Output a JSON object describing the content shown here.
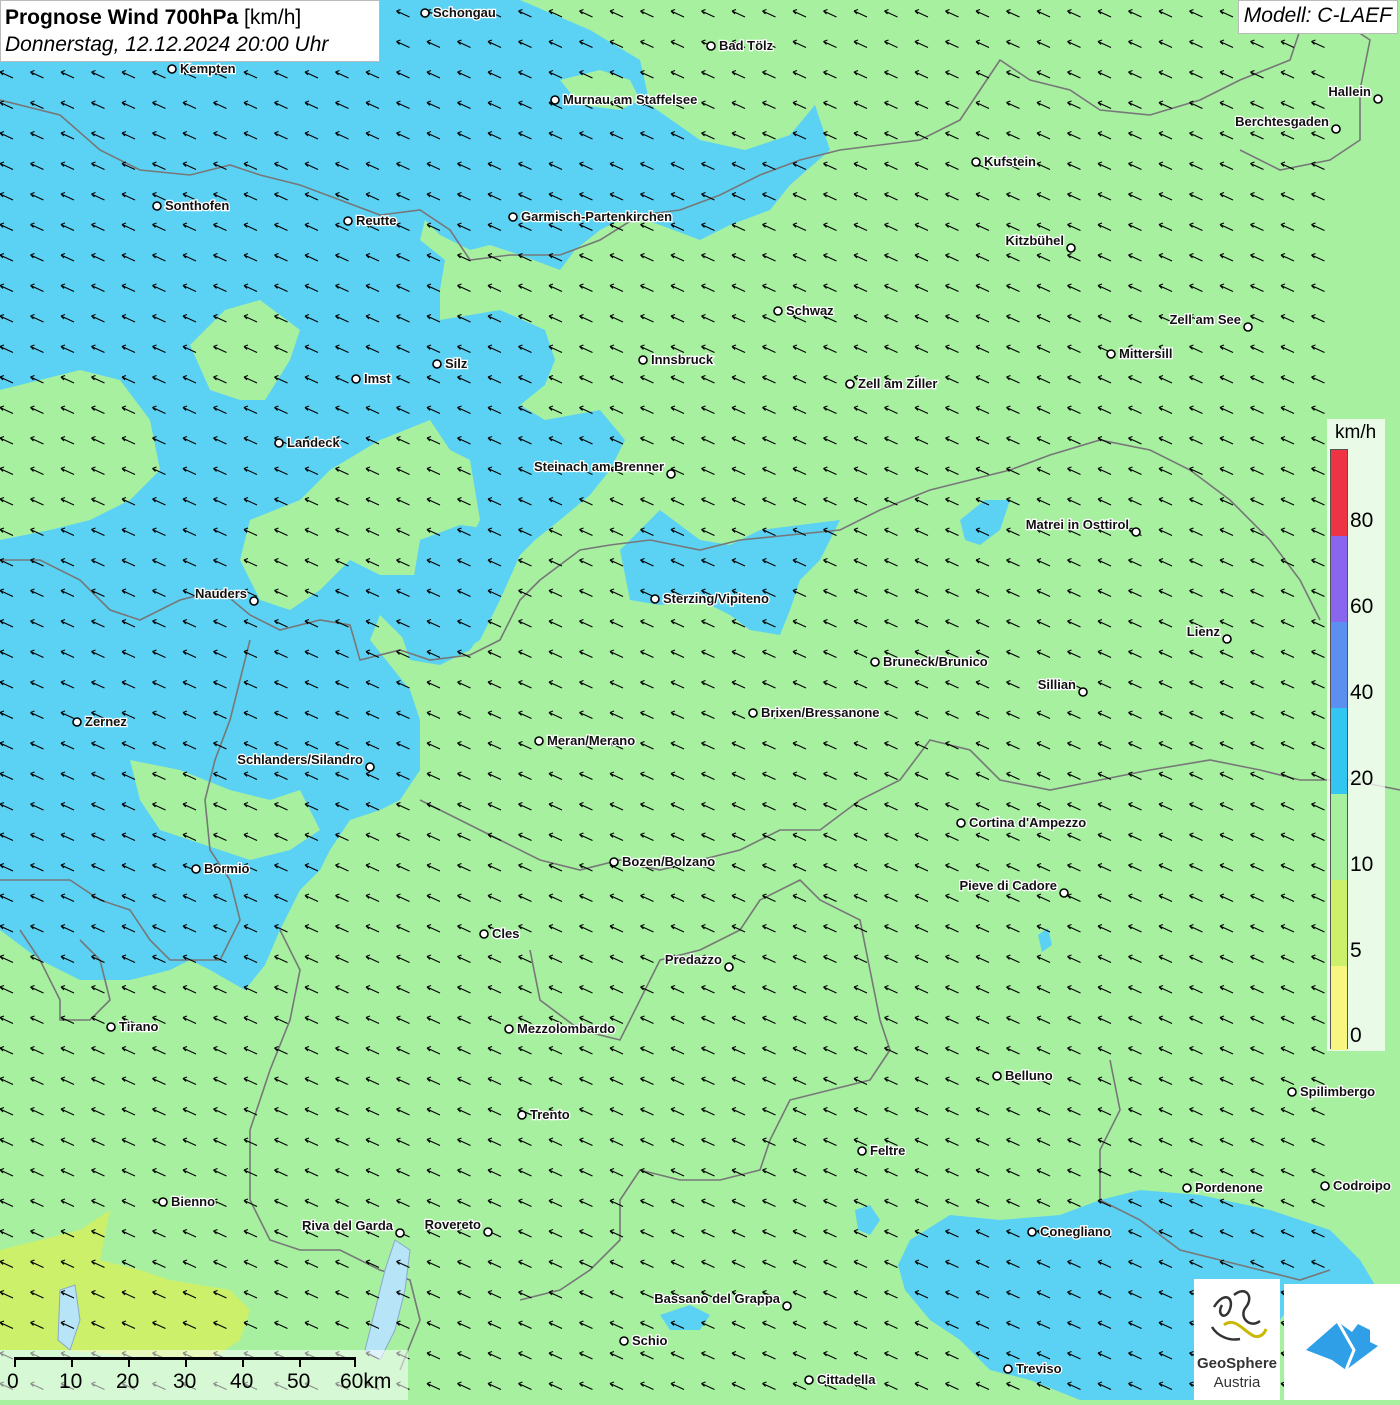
{
  "header": {
    "title_bold": "Prognose Wind 700hPa",
    "title_unit": "[km/h]",
    "subtitle": "Donnerstag, 12.12.2024 20:00 Uhr",
    "model": "Modell: C-LAEF"
  },
  "legend": {
    "unit": "km/h",
    "ticks": [
      "80",
      "60",
      "40",
      "20",
      "10",
      "5",
      "0"
    ],
    "classes": [
      {
        "color": "#ee3344"
      },
      {
        "color": "#8866ee"
      },
      {
        "color": "#5b8ff0"
      },
      {
        "color": "#33c6f2"
      },
      {
        "color": "#a6f0a0"
      },
      {
        "color": "#ccf06a"
      },
      {
        "color": "#f6f680"
      }
    ]
  },
  "scale": {
    "ticks": [
      "0",
      "10",
      "20",
      "30",
      "40",
      "50",
      "60km"
    ]
  },
  "logos": {
    "geosphere_name": "GeoSphere",
    "geosphere_sub": "Austria"
  },
  "colors": {
    "background": "#a6f0a0",
    "wind_20_40": "#5bd2f4",
    "wind_5_10": "#ccf06a",
    "borders": "#777777",
    "app_logo": "#2f9fe8"
  },
  "wind_direction": "from south-east towards north-west",
  "cities": [
    {
      "name": "Schongau"
    },
    {
      "name": "Bad Tölz"
    },
    {
      "name": "Kempten"
    },
    {
      "name": "Murnau am Staffelsee"
    },
    {
      "name": "Hallein"
    },
    {
      "name": "Berchtesgaden"
    },
    {
      "name": "Kufstein"
    },
    {
      "name": "Sonthofen"
    },
    {
      "name": "Reutte"
    },
    {
      "name": "Garmisch-Partenkirchen"
    },
    {
      "name": "Kitzbühel"
    },
    {
      "name": "Schwaz"
    },
    {
      "name": "Zell am See"
    },
    {
      "name": "Mittersill"
    },
    {
      "name": "Innsbruck"
    },
    {
      "name": "Silz"
    },
    {
      "name": "Imst"
    },
    {
      "name": "Zell am Ziller"
    },
    {
      "name": "Landeck"
    },
    {
      "name": "Steinach am Brenner"
    },
    {
      "name": "Matrei in Osttirol"
    },
    {
      "name": "Nauders"
    },
    {
      "name": "Sterzing/Vipiteno"
    },
    {
      "name": "Lienz"
    },
    {
      "name": "Bruneck/Brunico"
    },
    {
      "name": "Sillian"
    },
    {
      "name": "Brixen/Bressanone"
    },
    {
      "name": "Zernez"
    },
    {
      "name": "Meran/Merano"
    },
    {
      "name": "Schlanders/Silandro"
    },
    {
      "name": "Cortina d'Ampezzo"
    },
    {
      "name": "Bozen/Bolzano"
    },
    {
      "name": "Bormio"
    },
    {
      "name": "Pieve di Cadore"
    },
    {
      "name": "Cles"
    },
    {
      "name": "Predazzo"
    },
    {
      "name": "Tirano"
    },
    {
      "name": "Mezzolombardo"
    },
    {
      "name": "Belluno"
    },
    {
      "name": "Spilimbergo"
    },
    {
      "name": "Trento"
    },
    {
      "name": "Feltre"
    },
    {
      "name": "Pordenone"
    },
    {
      "name": "Codroipo"
    },
    {
      "name": "Bienno"
    },
    {
      "name": "Riva del Garda"
    },
    {
      "name": "Rovereto"
    },
    {
      "name": "Conegliano"
    },
    {
      "name": "Bassano del Grappa"
    },
    {
      "name": "Schio"
    },
    {
      "name": "Treviso"
    },
    {
      "name": "Cittadella"
    }
  ]
}
